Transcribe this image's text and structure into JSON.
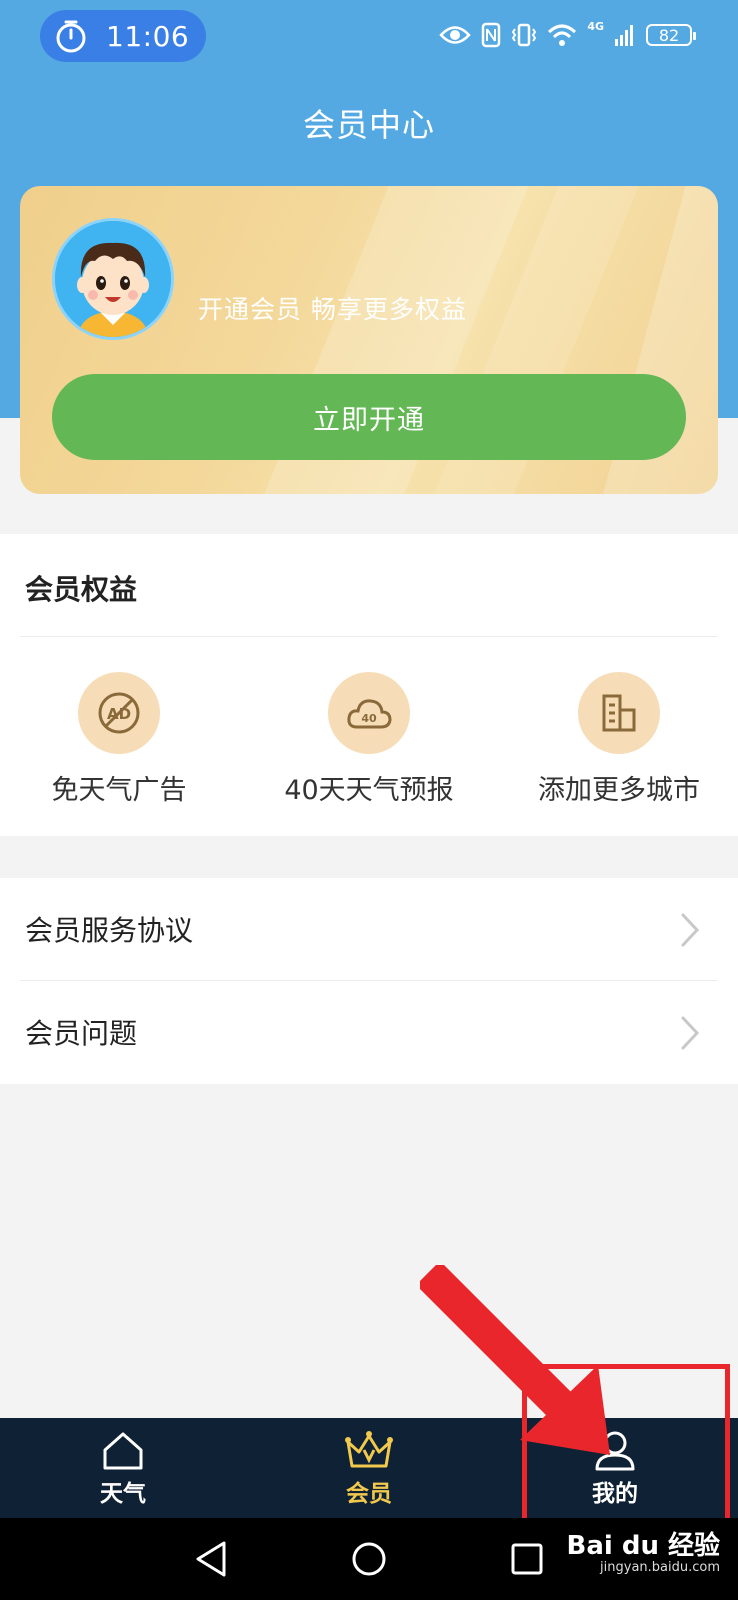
{
  "status_bar": {
    "time": "11:06",
    "network_label": "4G",
    "battery": "82"
  },
  "header": {
    "title": "会员中心"
  },
  "member_card": {
    "slogan": "开通会员 畅享更多权益",
    "open_button_label": "立即开通"
  },
  "benefits": {
    "title": "会员权益",
    "items": [
      {
        "label": "免天气广告",
        "icon": "no-ads-icon",
        "icon_text": "AD"
      },
      {
        "label": "40天天气预报",
        "icon": "cloud-40-icon",
        "icon_text": "40"
      },
      {
        "label": "添加更多城市",
        "icon": "city-buildings-icon"
      }
    ]
  },
  "links": [
    {
      "label": "会员服务协议"
    },
    {
      "label": "会员问题"
    }
  ],
  "tab_bar": {
    "tabs": [
      {
        "label": "天气",
        "icon": "home-icon",
        "active": false
      },
      {
        "label": "会员",
        "icon": "crown-icon",
        "active": true
      },
      {
        "label": "我的",
        "icon": "user-icon",
        "active": false
      }
    ],
    "active_color": "#f2c94c",
    "inactive_color": "#ffffff"
  },
  "watermark": {
    "logo": "Bai du 经验",
    "url": "jingyan.baidu.com"
  },
  "colors": {
    "header_bg": "#55a9e3",
    "button_green": "#63b755",
    "annotation_red": "#e8262b"
  }
}
